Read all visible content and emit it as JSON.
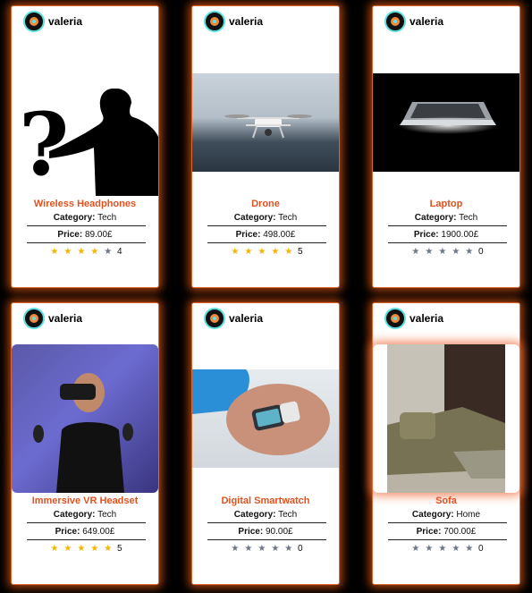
{
  "cards": [
    {
      "user": "valeria",
      "title": "Wireless Headphones",
      "category_label": "Category:",
      "category": "Tech",
      "price_label": "Price:",
      "price": "89.00£",
      "rating": 4,
      "rating_text": "4",
      "image": "question-silhouette"
    },
    {
      "user": "valeria",
      "title": "Drone",
      "category_label": "Category:",
      "category": "Tech",
      "price_label": "Price:",
      "price": "498.00£",
      "rating": 5,
      "rating_text": "5",
      "image": "drone-photo"
    },
    {
      "user": "valeria",
      "title": "Laptop",
      "category_label": "Category:",
      "category": "Tech",
      "price_label": "Price:",
      "price": "1900.00£",
      "rating": 0,
      "rating_text": "0",
      "image": "laptop-photo"
    },
    {
      "user": "valeria",
      "title": "Immersive VR Headset",
      "category_label": "Category:",
      "category": "Tech",
      "price_label": "Price:",
      "price": "649.00£",
      "rating": 5,
      "rating_text": "5",
      "image": "vr-headset-photo"
    },
    {
      "user": "valeria",
      "title": "Digital Smartwatch",
      "category_label": "Category:",
      "category": "Tech",
      "price_label": "Price:",
      "price": "90.00£",
      "rating": 0,
      "rating_text": "0",
      "image": "smartwatch-photo"
    },
    {
      "user": "valeria",
      "title": "Sofa",
      "category_label": "Category:",
      "category": "Home",
      "price_label": "Price:",
      "price": "700.00£",
      "rating": 0,
      "rating_text": "0",
      "image": "sofa-photo"
    }
  ],
  "colors": {
    "accent": "#e0521f",
    "star_on": "#f5b400",
    "star_off": "#6b7686",
    "glow": "#e65a14"
  }
}
